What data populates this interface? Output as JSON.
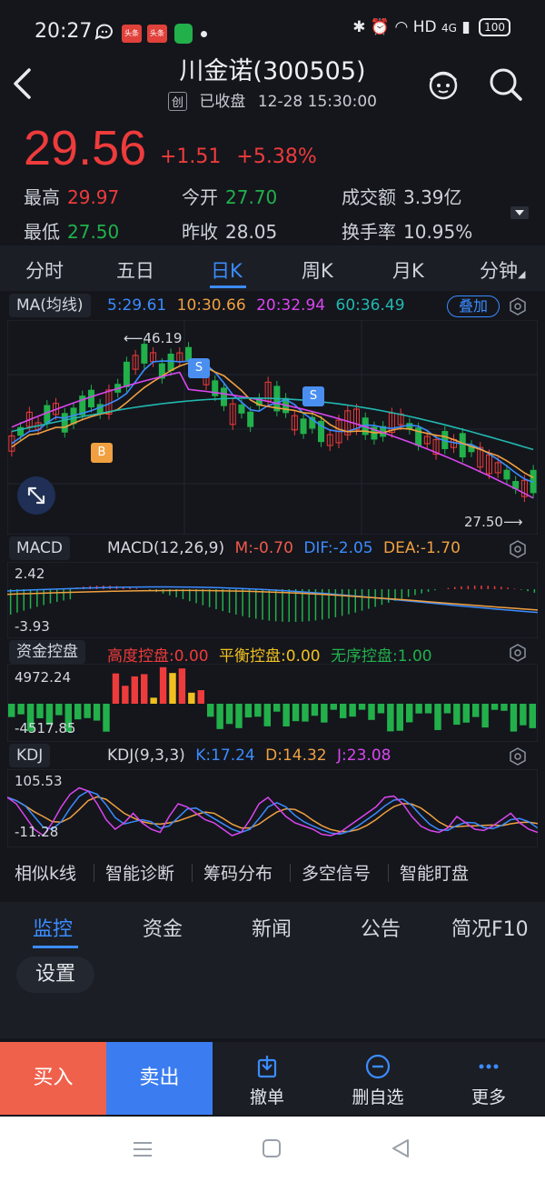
{
  "status_bar": {
    "time": "20:27",
    "chip1": "头条",
    "chip2": "头条",
    "network": "HD",
    "signal": "4G",
    "battery": "100"
  },
  "header": {
    "title": "川金诺(300505)",
    "board_tag": "创",
    "state": "已收盘",
    "datetime": "12-28 15:30:00"
  },
  "quote": {
    "price": "29.56",
    "change": "+1.51",
    "change_pct": "+5.38%",
    "high_label": "最高",
    "high": "29.97",
    "open_label": "今开",
    "open": "27.70",
    "volume_label": "成交额",
    "volume": "3.39亿",
    "low_label": "最低",
    "low": "27.50",
    "prev_close_label": "昨收",
    "prev_close": "28.05",
    "turnover_label": "换手率",
    "turnover": "10.95%"
  },
  "periods": [
    "分时",
    "五日",
    "日K",
    "周K",
    "月K",
    "分钟"
  ],
  "active_period": "日K",
  "ma": {
    "name": "MA(均线)",
    "ma5": "5:29.61",
    "ma10": "10:30.66",
    "ma20": "20:32.94",
    "ma60": "60:36.49",
    "overlay_label": "叠加",
    "high_marker": "46.19",
    "low_marker": "27.50",
    "buy_signal": "B",
    "sell_signal": "S",
    "colors": {
      "ma5": "#3b8cff",
      "ma10": "#f0a040",
      "ma20": "#d946ef",
      "ma60": "#22b8b0"
    }
  },
  "macd": {
    "name": "MACD",
    "params": "MACD(12,26,9)",
    "m": "M:-0.70",
    "dif": "DIF:-2.05",
    "dea": "DEA:-1.70",
    "ymax": "2.42",
    "ymin": "-3.93"
  },
  "capital": {
    "name": "资金控盘",
    "high": "高度控盘:0.00",
    "balance": "平衡控盘:0.00",
    "disorder": "无序控盘:1.00",
    "ymax": "4972.24",
    "ymin": "-4517.85"
  },
  "kdj": {
    "name": "KDJ",
    "params": "KDJ(9,3,3)",
    "k": "K:17.24",
    "d": "D:14.32",
    "j": "J:23.08",
    "ymax": "105.53",
    "ymin": "-11.28"
  },
  "tools": [
    "相似k线",
    "智能诊断",
    "筹码分布",
    "多空信号",
    "智能盯盘"
  ],
  "info_tabs": [
    "监控",
    "资金",
    "新闻",
    "公告",
    "简况F10"
  ],
  "settings_label": "设置",
  "bottom": {
    "buy": "买入",
    "sell": "卖出",
    "cancel": "撤单",
    "remove_watch": "删自选",
    "more": "更多"
  }
}
